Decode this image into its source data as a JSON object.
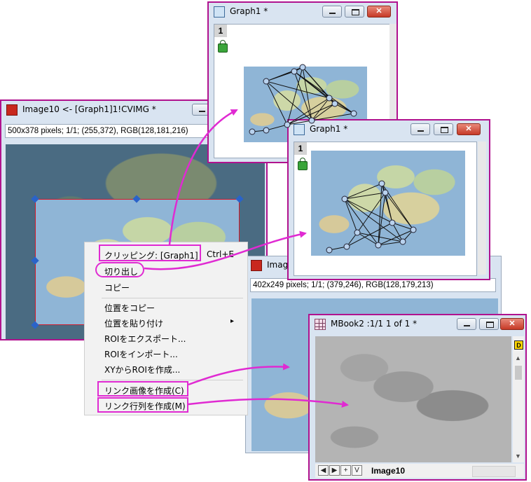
{
  "windows": {
    "image10": {
      "title": "Image10 <- [Graph1]1!CVIMG *",
      "info": "500x378 pixels; 1/1; (255,372), RGB(128,181,216)"
    },
    "graph1_top": {
      "title": "Graph1 *",
      "page_tab": "1"
    },
    "graph1_mid": {
      "title": "Graph1 *",
      "page_tab": "1"
    },
    "image_back": {
      "title": "Imag",
      "info": "402x249 pixels; 1/1; (379,246), RGB(128,179,213)"
    },
    "mbook2": {
      "title": "MBook2 :1/1 1 of 1 *",
      "badge": "D",
      "sheet_tab": "Image10",
      "nav_buttons": [
        "◀",
        "▶",
        "+",
        "V"
      ]
    }
  },
  "context_menu": {
    "items": [
      {
        "label": "クリッピング: [Graph1]",
        "shortcut": "Ctrl+E"
      },
      {
        "label": "切り出し"
      },
      {
        "label": "コピー"
      },
      {
        "label": "位置をコピー"
      },
      {
        "label": "位置を貼り付け",
        "submenu": "▸"
      },
      {
        "label": "ROIをエクスポート..."
      },
      {
        "label": "ROIをインポート..."
      },
      {
        "label": "XYからROIを作成..."
      },
      {
        "label": "リンク画像を作成(C)"
      },
      {
        "label": "リンク行列を作成(M)"
      }
    ]
  },
  "colors": {
    "annotation": "#e02ad2",
    "window_border": "#b0128e",
    "roi": "#d11a2a",
    "handle": "#2a63c9"
  },
  "icons": [
    "image-app-icon",
    "graph-app-icon",
    "matrix-book-icon",
    "lock-icon",
    "minimize-icon",
    "maximize-icon",
    "close-icon"
  ]
}
